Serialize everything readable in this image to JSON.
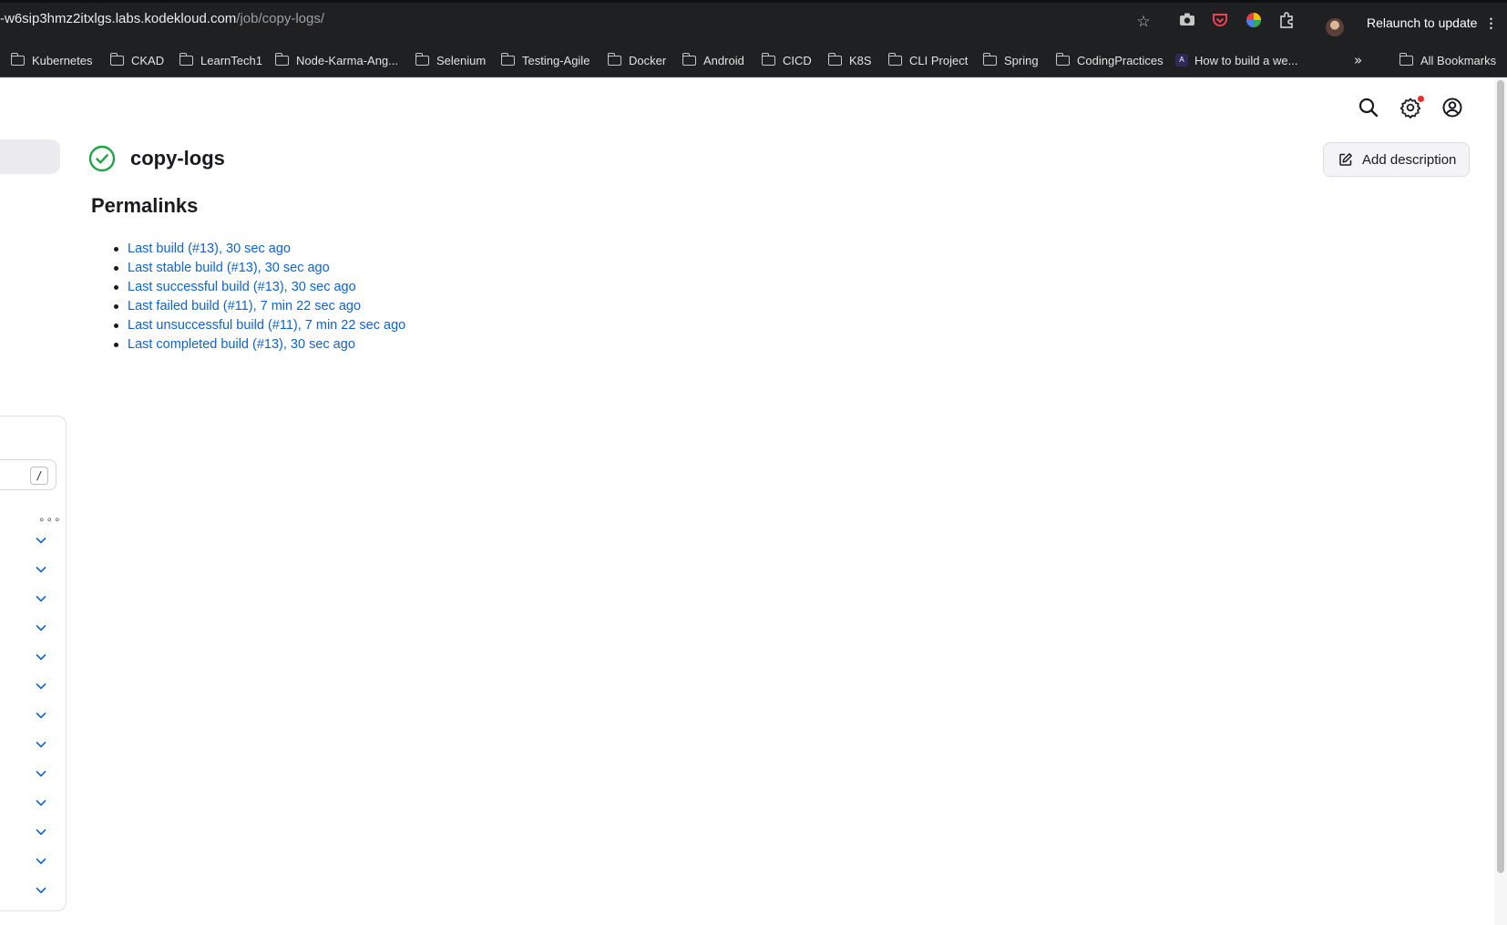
{
  "browser": {
    "url_host": "-w6sip3hmz2itxlgs.labs.kodekloud.com",
    "url_path": "/job/copy-logs/",
    "relaunch_label": "Relaunch to update",
    "bookmarks": [
      {
        "label": "Kubernetes"
      },
      {
        "label": "CKAD"
      },
      {
        "label": "LearnTech1"
      },
      {
        "label": "Node-Karma-Ang..."
      },
      {
        "label": "Selenium"
      },
      {
        "label": "Testing-Agile"
      },
      {
        "label": "Docker"
      },
      {
        "label": "Android"
      },
      {
        "label": "CICD"
      },
      {
        "label": "K8S"
      },
      {
        "label": "CLI Project"
      },
      {
        "label": "Spring"
      },
      {
        "label": "CodingPractices"
      },
      {
        "label": "How to build a we..."
      }
    ],
    "all_bookmarks_label": "All Bookmarks"
  },
  "job": {
    "name": "copy-logs",
    "status": "success",
    "status_color": "#1ea446",
    "add_description_label": "Add description"
  },
  "permalinks": {
    "heading": "Permalinks",
    "items": [
      "Last build (#13), 30 sec ago",
      "Last stable build (#13), 30 sec ago",
      "Last successful build (#13), 30 sec ago",
      "Last failed build (#11), 7 min 22 sec ago",
      "Last unsuccessful build (#11), 7 min 22 sec ago",
      "Last completed build (#13), 30 sec ago"
    ]
  },
  "sidebar": {
    "search_shortcut": "/",
    "collapsed_rows": 13
  },
  "colors": {
    "link": "#0b63d9",
    "notification": "#e62e2e"
  }
}
